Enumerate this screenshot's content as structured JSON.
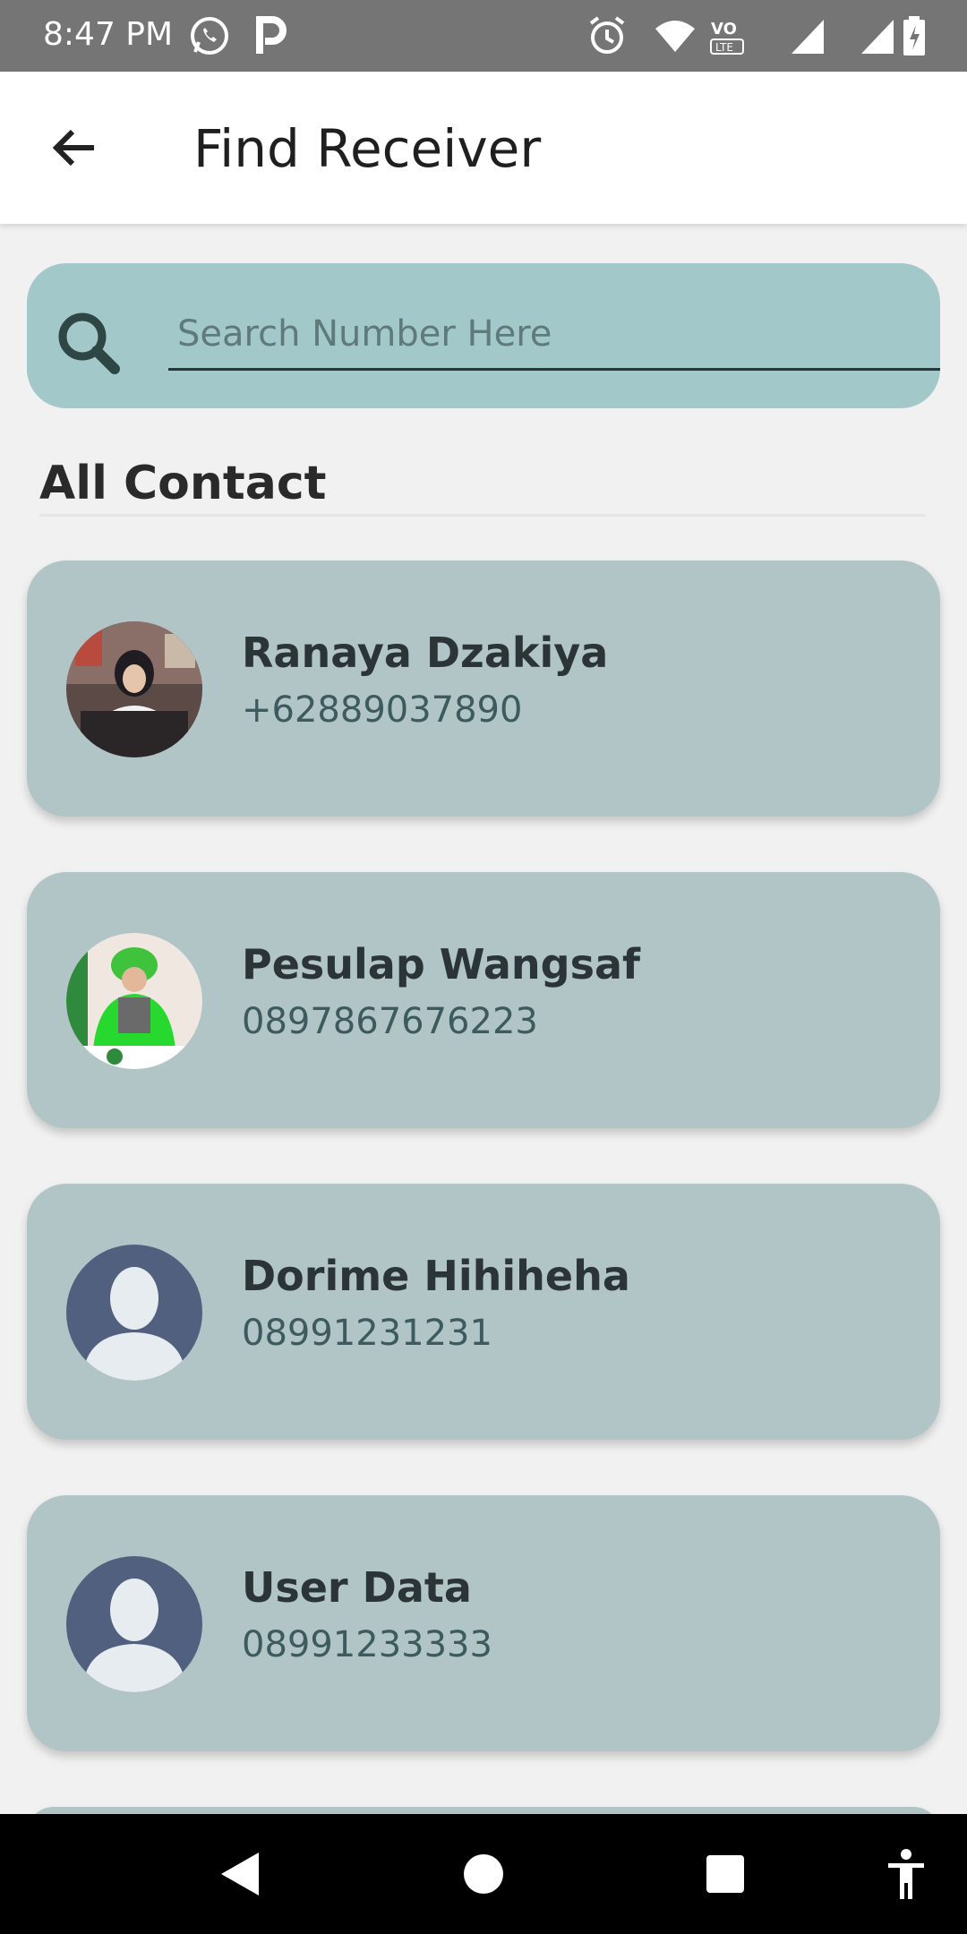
{
  "status_bar": {
    "time": "8:47 PM",
    "icons": [
      "whatsapp-icon",
      "p-icon",
      "alarm-icon",
      "wifi-icon",
      "volte-icon",
      "signal-icon",
      "signal-icon",
      "battery-icon"
    ]
  },
  "header": {
    "title": "Find Receiver"
  },
  "search": {
    "placeholder": "Search Number Here",
    "value": ""
  },
  "section": {
    "title": "All Contact"
  },
  "contacts": [
    {
      "name": "Ranaya Dzakiya",
      "number": "+62889037890",
      "avatar": "photo"
    },
    {
      "name": "Pesulap Wangsaf",
      "number": "0897867676223",
      "avatar": "photo"
    },
    {
      "name": "Dorime Hihiheha",
      "number": "08991231231",
      "avatar": "default"
    },
    {
      "name": "User Data",
      "number": "08991233333",
      "avatar": "default"
    }
  ],
  "colors": {
    "search_bg": "#a3c8c9",
    "card_bg": "#b1c5c7",
    "default_avatar": "#52607f"
  }
}
